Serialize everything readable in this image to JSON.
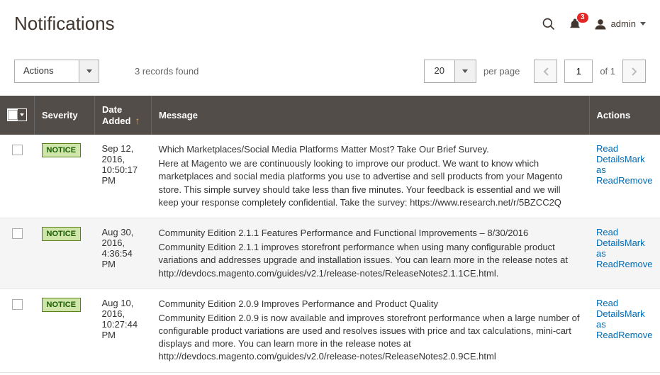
{
  "header": {
    "title": "Notifications",
    "badge_count": "3",
    "username": "admin"
  },
  "toolbar": {
    "actions_label": "Actions",
    "records_found": "3 records found",
    "page_size": "20",
    "per_page_label": "per page",
    "current_page": "1",
    "of_label": "of 1"
  },
  "columns": {
    "severity": "Severity",
    "date_added": "Date Added",
    "message": "Message",
    "actions": "Actions"
  },
  "severity_label": "NOTICE",
  "action_links": {
    "read_details": "Read Details",
    "mark_as_read": "Mark as Read",
    "remove": "Remove"
  },
  "rows": [
    {
      "date": "Sep 12, 2016, 10:50:17 PM",
      "title": "Which Marketplaces/Social Media Platforms Matter Most? Take Our Brief Survey.",
      "body": "Here at Magento we are continuously looking to improve our product. We want to know which marketplaces and social media platforms you use to advertise and sell products from your Magento store. This simple survey should take less than five minutes. Your feedback is essential and we will keep your response completely confidential. Take the survey: https://www.research.net/r/5BZCC2Q"
    },
    {
      "date": "Aug 30, 2016, 4:36:54 PM",
      "title": "Community Edition 2.1.1 Features Performance and Functional Improvements – 8/30/2016",
      "body": "Community Edition 2.1.1 improves storefront performance when using many configurable product variations and addresses upgrade and installation issues. You can learn more in the release notes at http://devdocs.magento.com/guides/v2.1/release-notes/ReleaseNotes2.1.1CE.html."
    },
    {
      "date": "Aug 10, 2016, 10:27:44 PM",
      "title": "Community Edition 2.0.9 Improves Performance and Product Quality",
      "body": "Community Edition 2.0.9 is now available and improves storefront performance when a large number of configurable product variations are used and resolves issues with price and tax calculations, mini-cart displays and more. You can learn more in the release notes at http://devdocs.magento.com/guides/v2.0/release-notes/ReleaseNotes2.0.9CE.html"
    }
  ]
}
